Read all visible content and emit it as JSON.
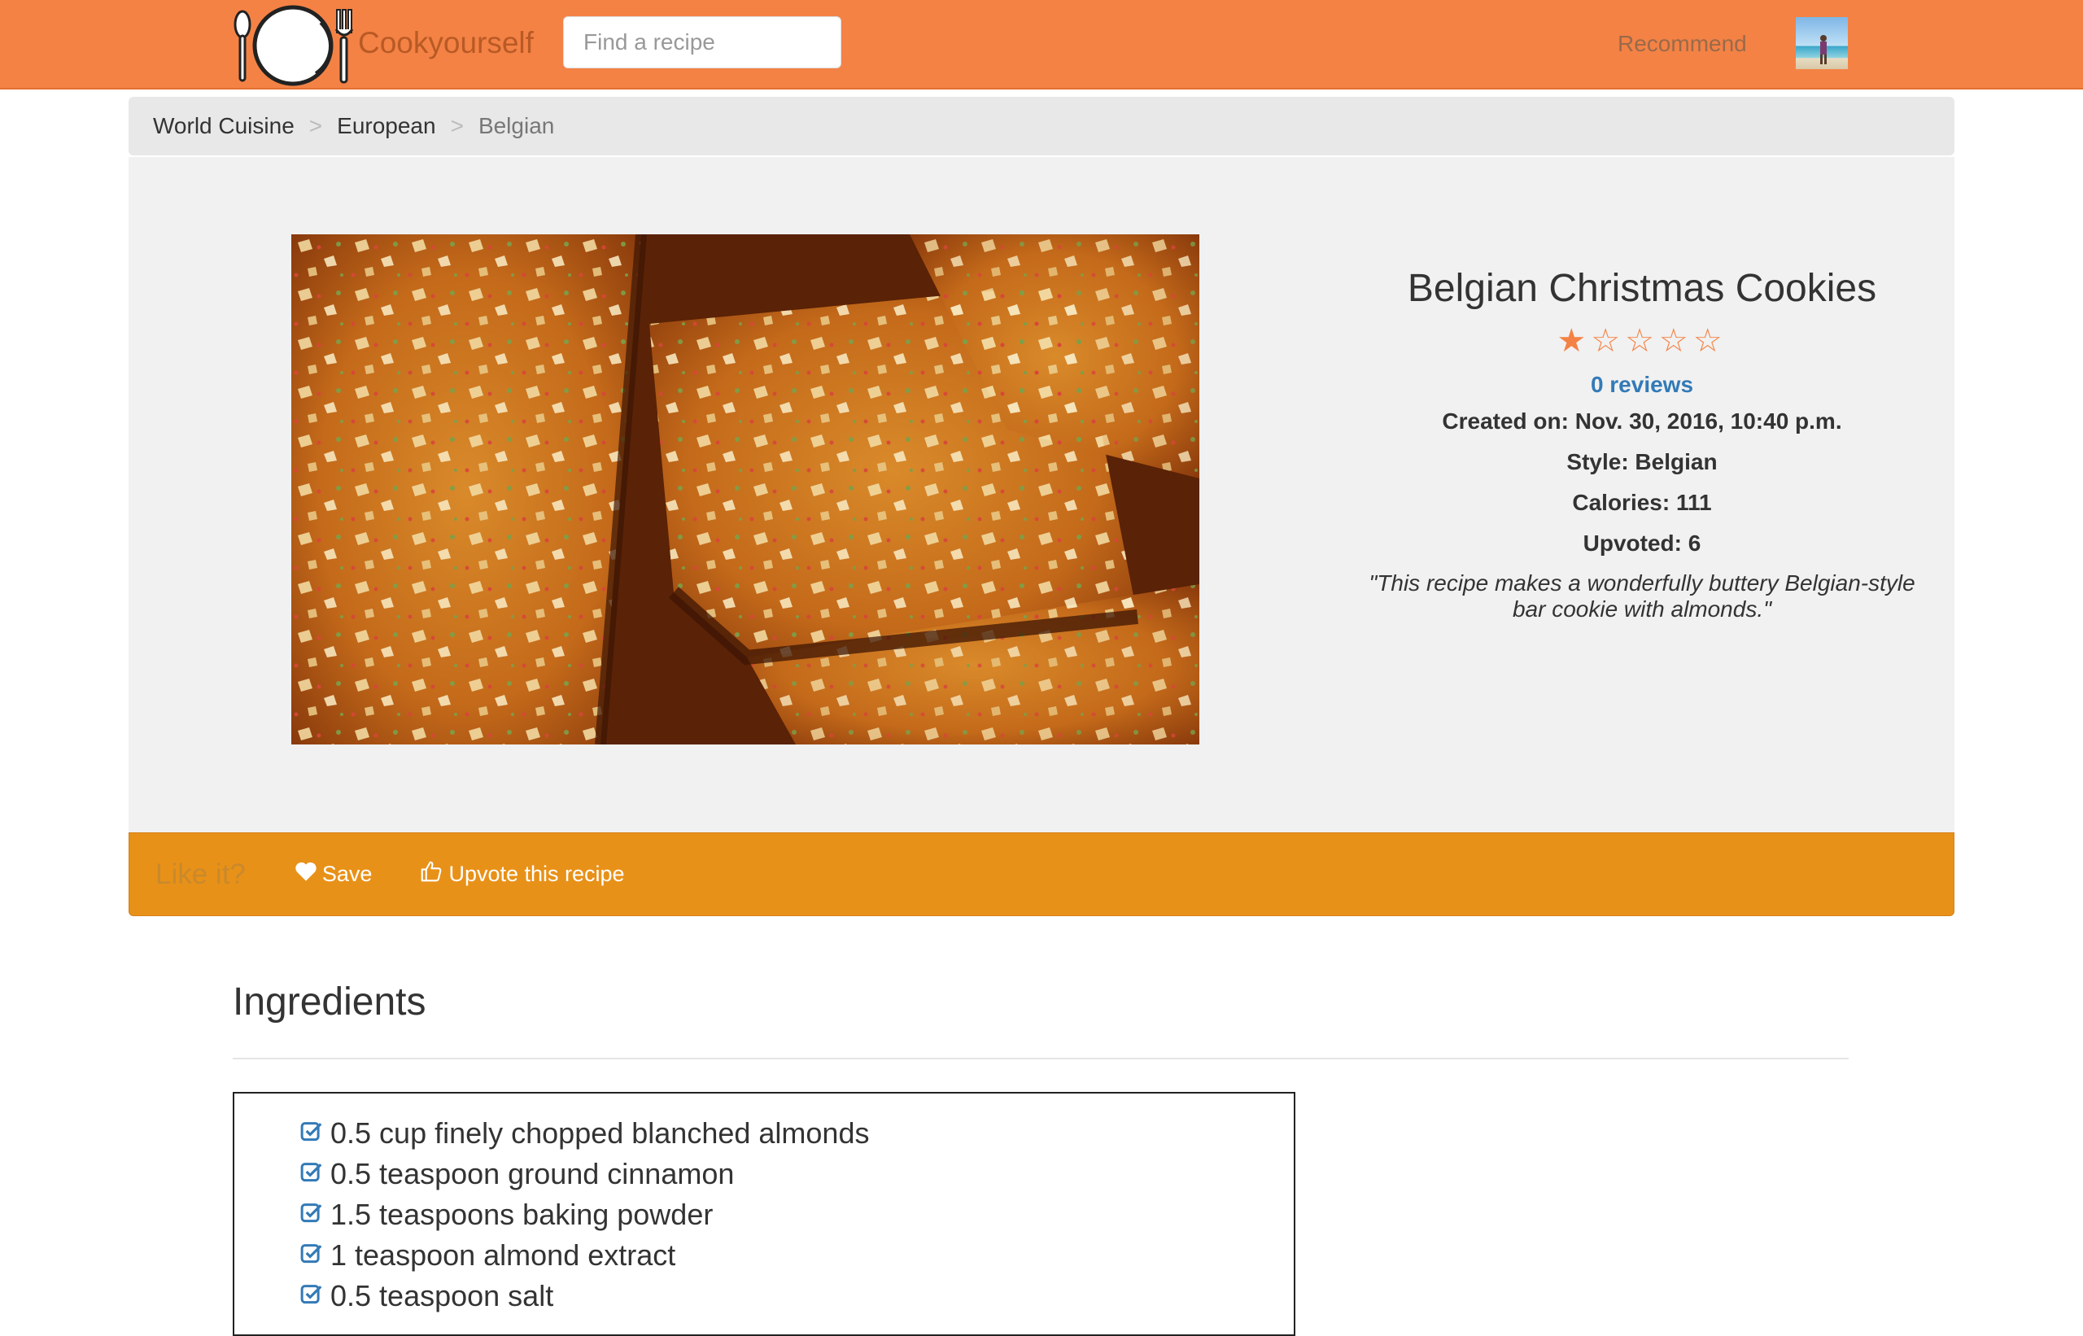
{
  "navbar": {
    "brand": "Cookyourself",
    "search_placeholder": "Find a recipe",
    "recommend_label": "Recommend",
    "accent_color": "#f48245"
  },
  "breadcrumb": {
    "items": [
      "World Cuisine",
      "European",
      "Belgian"
    ],
    "separator": ">"
  },
  "recipe": {
    "title": "Belgian Christmas Cookies",
    "rating": 1,
    "rating_max": 5,
    "stars_display": "★☆☆☆☆",
    "reviews_label": "0 reviews",
    "created": "Created on: Nov. 30, 2016, 10:40 p.m.",
    "style": "Style: Belgian",
    "calories": "Calories: 111",
    "upvoted": "Upvoted: 6",
    "description": "\"This recipe makes a wonderfully buttery Belgian-style bar cookie with almonds.\""
  },
  "actions": {
    "prompt": "Like it?",
    "save_label": "Save",
    "upvote_label": "Upvote this recipe",
    "bar_color": "#e89118"
  },
  "ingredients": {
    "heading": "Ingredients",
    "items": [
      "0.5 cup finely chopped blanched almonds",
      "0.5 teaspoon ground cinnamon",
      "1.5 teaspoons baking powder",
      "1 teaspoon almond extract",
      "0.5 teaspoon salt"
    ]
  },
  "icons": {
    "logo": "plate-with-spoon-and-fork-icon",
    "save": "heart-icon",
    "upvote": "thumbs-up-icon",
    "ingredient_check": "checked-checkbox-icon"
  }
}
